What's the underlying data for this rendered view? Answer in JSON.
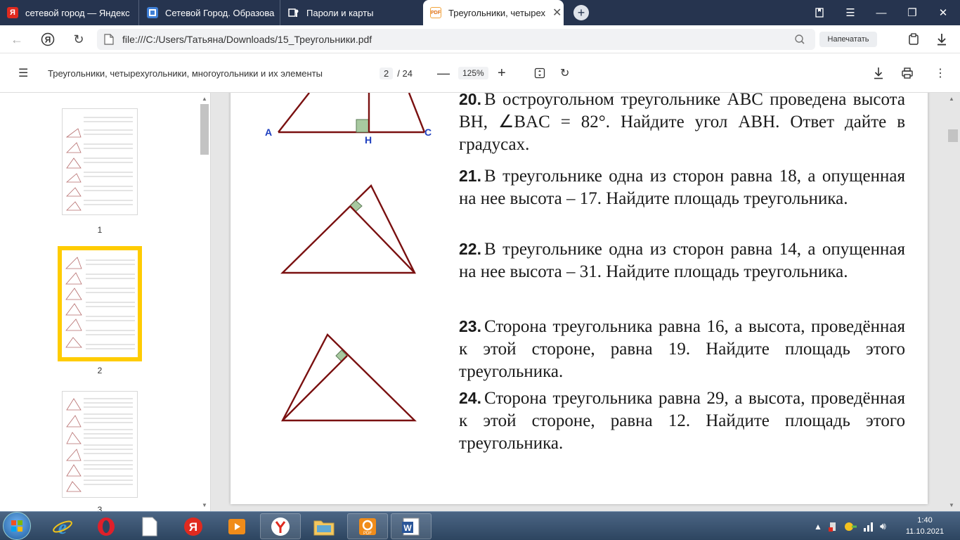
{
  "tabs": [
    {
      "title": "сетевой город — Яндекс",
      "favicon": "Я"
    },
    {
      "title": "Сетевой Город. Образова",
      "favicon": ""
    },
    {
      "title": "Пароли и карты",
      "favicon": ""
    },
    {
      "title": "Треугольники, четырех",
      "favicon": "pdf",
      "active": true
    }
  ],
  "address": {
    "url": "file:///C:/Users/Татьяна/Downloads/15_Треугольники.pdf",
    "print_label": "Напечатать"
  },
  "pdf_toolbar": {
    "doc_title": "Треугольники, четырехугольники, многоугольники и их элементы",
    "current_page": "2",
    "total_pages": "/ 24",
    "zoom": "125%"
  },
  "thumbnails": [
    {
      "label": "1"
    },
    {
      "label": "2"
    },
    {
      "label": "3"
    }
  ],
  "figure_labels": {
    "a": "A",
    "h": "H",
    "c": "C"
  },
  "problems": [
    {
      "num": "20.",
      "text": "В остроугольном треугольнике ABC проведена высота BH, ∠BAC = 82°. Найдите угол ABH. Ответ дайте в градусах."
    },
    {
      "num": "21.",
      "text": "В треугольнике одна из сторон равна 18, а опущенная на нее высота – 17. Найдите площадь треугольника."
    },
    {
      "num": "22.",
      "text": "В треугольнике одна из сторон равна 14, а опущенная на нее высота – 31. Найдите площадь треугольника."
    },
    {
      "num": "23.",
      "text": "Сторона треугольника равна 16, а высота, проведённая к этой стороне, равна 19. Найдите площадь этого треугольника."
    },
    {
      "num": "24.",
      "text": "Сторона треугольника равна 29, а высота, проведённая к этой стороне, равна 12. Найдите площадь этого треугольника."
    }
  ],
  "taskbar": {
    "time": "1:40",
    "date": "11.10.2021"
  },
  "colors": {
    "tabbar": "#26344f",
    "triangle": "#7a1010",
    "right_angle_fill": "#a8c9a0",
    "label_blue": "#1e3fbf",
    "thumb_selected": "#ffcc00"
  }
}
